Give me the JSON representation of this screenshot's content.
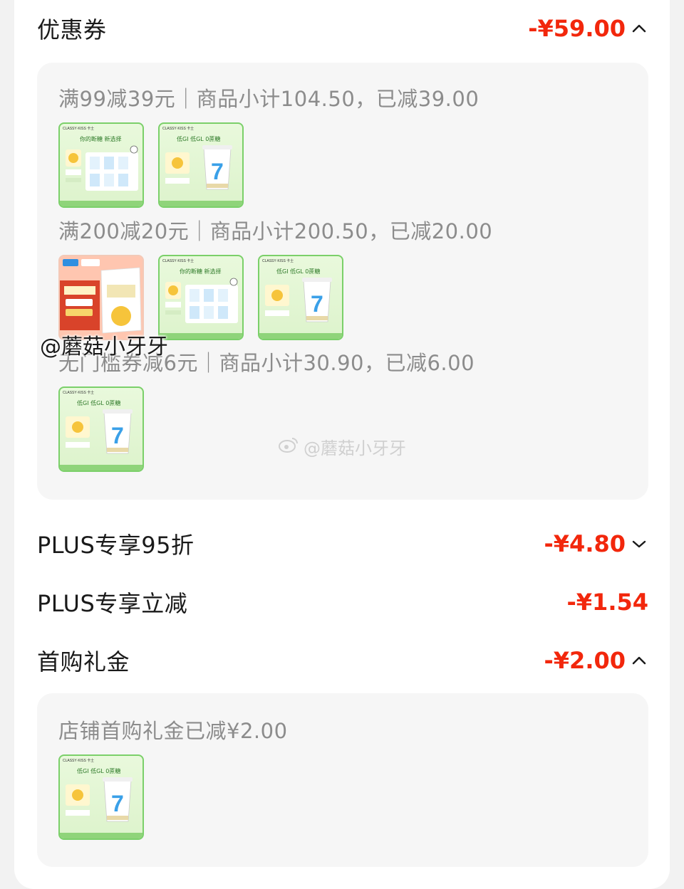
{
  "coupons": {
    "title": "优惠券",
    "amount": "-¥59.00",
    "rules": [
      {
        "text": "满99减39元｜商品小计104.50，已减39.00"
      },
      {
        "text": "满200减20元｜商品小计200.50，已减20.00"
      },
      {
        "text": "无门槛券减6元｜商品小计30.90，已减6.00"
      }
    ]
  },
  "plus_discount": {
    "title": "PLUS专享95折",
    "amount": "-¥4.80"
  },
  "plus_instant": {
    "title": "PLUS专享立减",
    "amount": "-¥1.54"
  },
  "first_purchase": {
    "title": "首购礼金",
    "amount": "-¥2.00",
    "detail": "店铺首购礼金已减¥2.00"
  },
  "product_thumb": {
    "brand": "CLASSY·KISS 卡士",
    "slogan_a": "你的断糖 新选择",
    "slogan_b": "低GI 低GL 0蔗糖",
    "cup_number": "7"
  },
  "watermarks": {
    "overlay": "@蘑菇小牙牙",
    "weibo": "@蘑菇小牙牙"
  },
  "colors": {
    "accent": "#f2270c",
    "panel": "#f6f6f6",
    "muted_text": "#8c8c8c"
  }
}
